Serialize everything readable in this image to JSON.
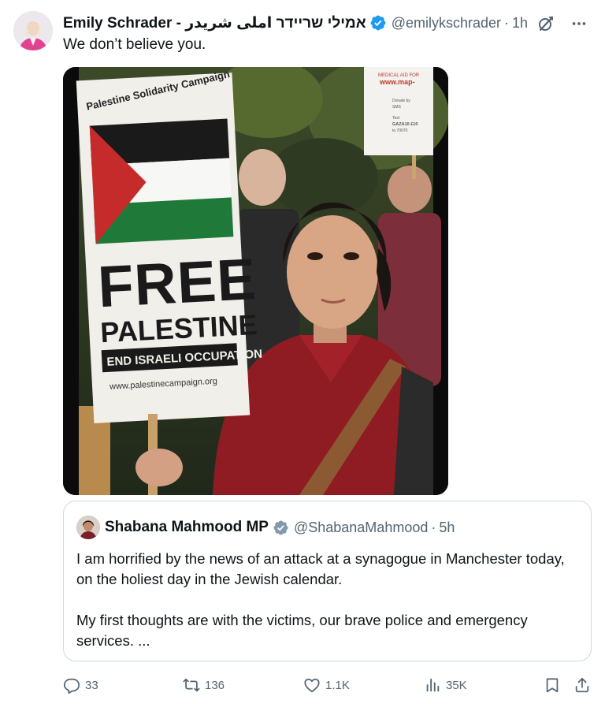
{
  "tweet": {
    "author": {
      "display_name": "Emily Schrader - אמילי שריידר املی شریدر",
      "handle": "@emilykschrader",
      "verified": true
    },
    "separator": "·",
    "time": "1h",
    "text": "We don’t believe you.",
    "header_icons": [
      "grok-icon",
      "more-icon"
    ],
    "media": {
      "sign_text": {
        "campaign": "Palestine Solidarity Campaign",
        "headline_1": "FREE",
        "headline_2": "PALESTINE",
        "subline": "END ISRAELI OCCUPATION",
        "url": "www.palestinecampaign.org"
      },
      "back_sign_text": {
        "top": "MEDICAL AID FOR",
        "url": "www.map-",
        "donate": "Donate by",
        "sms": "SMS",
        "text_label": "Text",
        "code": "GAZA10 £10",
        "to": "to 70070"
      }
    },
    "quote": {
      "author": {
        "display_name": "Shabana Mahmood MP",
        "handle": "@ShabanaMahmood",
        "verified": true,
        "verified_color": "#829aab"
      },
      "separator": "·",
      "time": "5h",
      "paragraphs": [
        "I am horrified by the news of an attack at a synagogue in Manchester today, on the holiest day in the Jewish calendar.",
        "My first thoughts are with the victims, our brave police and emergency services. ..."
      ]
    },
    "actions": {
      "replies": "33",
      "reposts": "136",
      "likes": "1.1K",
      "views": "35K"
    },
    "colors": {
      "verified_blue": "#1d9bf0",
      "text_primary": "#0f1419",
      "text_secondary": "#536471",
      "border": "#cfd9de"
    }
  }
}
